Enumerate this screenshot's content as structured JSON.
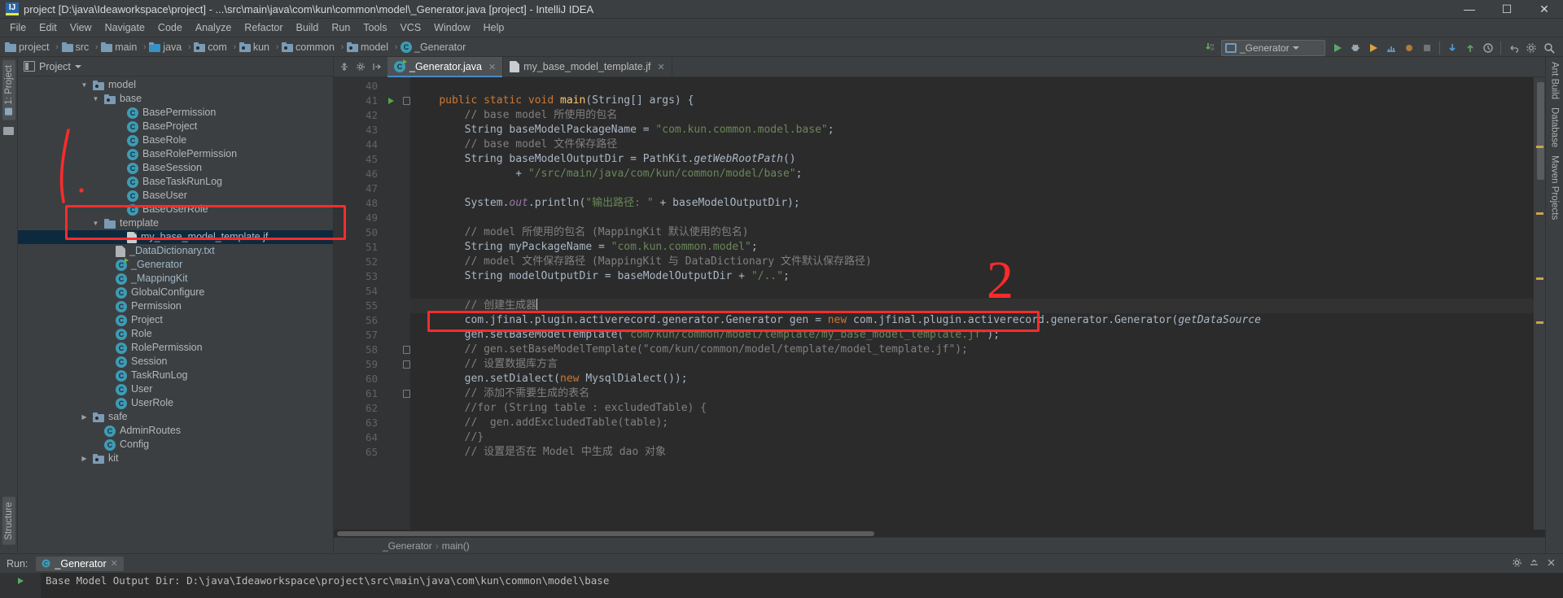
{
  "window": {
    "title": "project [D:\\java\\Ideaworkspace\\project] - ...\\src\\main\\java\\com\\kun\\common\\model\\_Generator.java [project] - IntelliJ IDEA",
    "logo": "IJ",
    "minimize": "—",
    "maximize": "☐",
    "close": "✕"
  },
  "menu": [
    "File",
    "Edit",
    "View",
    "Navigate",
    "Code",
    "Analyze",
    "Refactor",
    "Build",
    "Run",
    "Tools",
    "VCS",
    "Window",
    "Help"
  ],
  "navbar": {
    "crumbs": [
      {
        "label": "project",
        "icon": "folder-project-icon"
      },
      {
        "label": "src",
        "icon": "folder-icon"
      },
      {
        "label": "main",
        "icon": "folder-icon"
      },
      {
        "label": "java",
        "icon": "folder-source-icon"
      },
      {
        "label": "com",
        "icon": "folder-package-icon"
      },
      {
        "label": "kun",
        "icon": "folder-package-icon"
      },
      {
        "label": "common",
        "icon": "folder-package-icon"
      },
      {
        "label": "model",
        "icon": "folder-package-icon"
      },
      {
        "label": "_Generator",
        "icon": "java-class-icon"
      }
    ],
    "run_config": "_Generator",
    "separator": "›"
  },
  "left_strip": {
    "project_tab": "1: Project",
    "structure_tab": "Structure"
  },
  "right_strip": {
    "tabs": [
      "Ant Build",
      "Database",
      "Maven Projects"
    ]
  },
  "project_panel": {
    "title": "Project",
    "tree": [
      {
        "label": "model",
        "indent": 5,
        "arrow": "▼",
        "icon": "folder-package-icon",
        "selected": false
      },
      {
        "label": "base",
        "indent": 6,
        "arrow": "▼",
        "icon": "folder-package-icon",
        "selected": false
      },
      {
        "label": "BasePermission",
        "indent": 8,
        "arrow": "",
        "icon": "java-class-abstract-icon",
        "selected": false
      },
      {
        "label": "BaseProject",
        "indent": 8,
        "arrow": "",
        "icon": "java-class-abstract-icon",
        "selected": false
      },
      {
        "label": "BaseRole",
        "indent": 8,
        "arrow": "",
        "icon": "java-class-abstract-icon",
        "selected": false
      },
      {
        "label": "BaseRolePermission",
        "indent": 8,
        "arrow": "",
        "icon": "java-class-abstract-icon",
        "selected": false
      },
      {
        "label": "BaseSession",
        "indent": 8,
        "arrow": "",
        "icon": "java-class-abstract-icon",
        "selected": false
      },
      {
        "label": "BaseTaskRunLog",
        "indent": 8,
        "arrow": "",
        "icon": "java-class-abstract-icon",
        "selected": false
      },
      {
        "label": "BaseUser",
        "indent": 8,
        "arrow": "",
        "icon": "java-class-abstract-icon",
        "selected": false
      },
      {
        "label": "BaseUserRole",
        "indent": 8,
        "arrow": "",
        "icon": "java-class-abstract-icon",
        "selected": false
      },
      {
        "label": "template",
        "indent": 6,
        "arrow": "▼",
        "icon": "folder-icon",
        "selected": false
      },
      {
        "label": "my_base_model_template.jf",
        "indent": 8,
        "arrow": "",
        "icon": "file-jf-icon",
        "selected": true
      },
      {
        "label": "_DataDictionary.txt",
        "indent": 7,
        "arrow": "",
        "icon": "file-txt-icon",
        "selected": false
      },
      {
        "label": "_Generator",
        "indent": 7,
        "arrow": "",
        "icon": "java-class-runnable-icon",
        "selected": false
      },
      {
        "label": "_MappingKit",
        "indent": 7,
        "arrow": "",
        "icon": "java-class-icon",
        "selected": false
      },
      {
        "label": "GlobalConfigure",
        "indent": 7,
        "arrow": "",
        "icon": "java-class-icon",
        "selected": false
      },
      {
        "label": "Permission",
        "indent": 7,
        "arrow": "",
        "icon": "java-class-icon",
        "selected": false
      },
      {
        "label": "Project",
        "indent": 7,
        "arrow": "",
        "icon": "java-class-icon",
        "selected": false
      },
      {
        "label": "Role",
        "indent": 7,
        "arrow": "",
        "icon": "java-class-icon",
        "selected": false
      },
      {
        "label": "RolePermission",
        "indent": 7,
        "arrow": "",
        "icon": "java-class-icon",
        "selected": false
      },
      {
        "label": "Session",
        "indent": 7,
        "arrow": "",
        "icon": "java-class-icon",
        "selected": false
      },
      {
        "label": "TaskRunLog",
        "indent": 7,
        "arrow": "",
        "icon": "java-class-icon",
        "selected": false
      },
      {
        "label": "User",
        "indent": 7,
        "arrow": "",
        "icon": "java-class-icon",
        "selected": false
      },
      {
        "label": "UserRole",
        "indent": 7,
        "arrow": "",
        "icon": "java-class-icon",
        "selected": false
      },
      {
        "label": "safe",
        "indent": 5,
        "arrow": "▶",
        "icon": "folder-package-icon",
        "selected": false
      },
      {
        "label": "AdminRoutes",
        "indent": 6,
        "arrow": "",
        "icon": "java-class-icon",
        "selected": false
      },
      {
        "label": "Config",
        "indent": 6,
        "arrow": "",
        "icon": "java-class-icon",
        "selected": false
      },
      {
        "label": "kit",
        "indent": 5,
        "arrow": "▶",
        "icon": "folder-package-icon",
        "selected": false
      }
    ]
  },
  "editor": {
    "tabs": [
      {
        "label": "_Generator.java",
        "icon": "java-class-runnable-icon",
        "active": true,
        "close": "✕"
      },
      {
        "label": "my_base_model_template.jf",
        "icon": "file-jf-icon",
        "active": false,
        "close": "✕"
      }
    ],
    "first_line": 40,
    "current_line": 55,
    "lines": [
      {
        "n": 40,
        "html": ""
      },
      {
        "n": 41,
        "html": "    <span class=\"kw\">public static void</span> <span class=\"mth\">main</span>(String[] args) {",
        "run": true,
        "fold": true
      },
      {
        "n": 42,
        "html": "        <span class=\"cm\">// base model 所使用的包名</span>"
      },
      {
        "n": 43,
        "html": "        String baseModelPackageName = <span class=\"str\">\"com.kun.common.model.base\"</span>;"
      },
      {
        "n": 44,
        "html": "        <span class=\"cm\">// base model 文件保存路径</span>"
      },
      {
        "n": 45,
        "html": "        String baseModelOutputDir = PathKit.<span class=\"ital\">getWebRootPath</span>()"
      },
      {
        "n": 46,
        "html": "                + <span class=\"str\">\"/src/main/java/com/kun/common/model/base\"</span>;"
      },
      {
        "n": 47,
        "html": ""
      },
      {
        "n": 48,
        "html": "        System.<span class=\"fld\">out</span>.println(<span class=\"str\">\"输出路径: \"</span> + baseModelOutputDir);"
      },
      {
        "n": 49,
        "html": ""
      },
      {
        "n": 50,
        "html": "        <span class=\"cm\">// model 所使用的包名 (MappingKit 默认使用的包名)</span>"
      },
      {
        "n": 51,
        "html": "        String myPackageName = <span class=\"str\">\"com.kun.common.model\"</span>;"
      },
      {
        "n": 52,
        "html": "        <span class=\"cm\">// model 文件保存路径 (MappingKit 与 DataDictionary 文件默认保存路径)</span>"
      },
      {
        "n": 53,
        "html": "        String modelOutputDir = baseModelOutputDir + <span class=\"str\">\"/..\"</span>;"
      },
      {
        "n": 54,
        "html": ""
      },
      {
        "n": 55,
        "html": "        <span class=\"cm\">// 创建生成器</span><span class=\"caretbar\"></span>",
        "current": true
      },
      {
        "n": 56,
        "html": "        com.jfinal.plugin.activerecord.generator.Generator gen = <span class=\"kw\">new</span> com.jfinal.plugin.activerecord.generator.Generator(<span class=\"ital\">getDataSource</span>"
      },
      {
        "n": 57,
        "html": "        gen.setBaseModelTemplate(<span class=\"str\">\"com/kun/common/model/template/my_base_model_template.jf\"</span>);"
      },
      {
        "n": 58,
        "html": "        <span class=\"cm\">// gen.setBaseModelTemplate(\"com/kun/common/model/template/model_template.jf\");</span>",
        "fold": true
      },
      {
        "n": 59,
        "html": "        <span class=\"cm\">// 设置数据库方言</span>",
        "fold": true
      },
      {
        "n": 60,
        "html": "        gen.setDialect(<span class=\"kw\">new</span> MysqlDialect());"
      },
      {
        "n": 61,
        "html": "        <span class=\"cm\">// 添加不需要生成的表名</span>",
        "fold": true
      },
      {
        "n": 62,
        "html": "        <span class=\"cm\">//for (String table : excludedTable) {</span>"
      },
      {
        "n": 63,
        "html": "        <span class=\"cm\">//  gen.addExcludedTable(table);</span>"
      },
      {
        "n": 64,
        "html": "        <span class=\"cm\">//}</span>"
      },
      {
        "n": 65,
        "html": "        <span class=\"cm\">// 设置是否在 Model 中生成 dao 对象</span>"
      }
    ],
    "breadcrumb": [
      "_Generator",
      "main()"
    ]
  },
  "run_panel": {
    "label": "Run:",
    "tab": "_Generator",
    "tab_close": "✕",
    "console_line": "Base Model Output Dir: D:\\java\\Ideaworkspace\\project\\src\\main\\java\\com\\kun\\common\\model\\base"
  },
  "annotations": {
    "number_two": "2"
  },
  "colors": {
    "accent": "#4a88c7",
    "annotation_red": "#ff2b2b",
    "selection": "#0d293e",
    "editor_bg": "#2b2b2b",
    "panel_bg": "#3c3f41"
  }
}
